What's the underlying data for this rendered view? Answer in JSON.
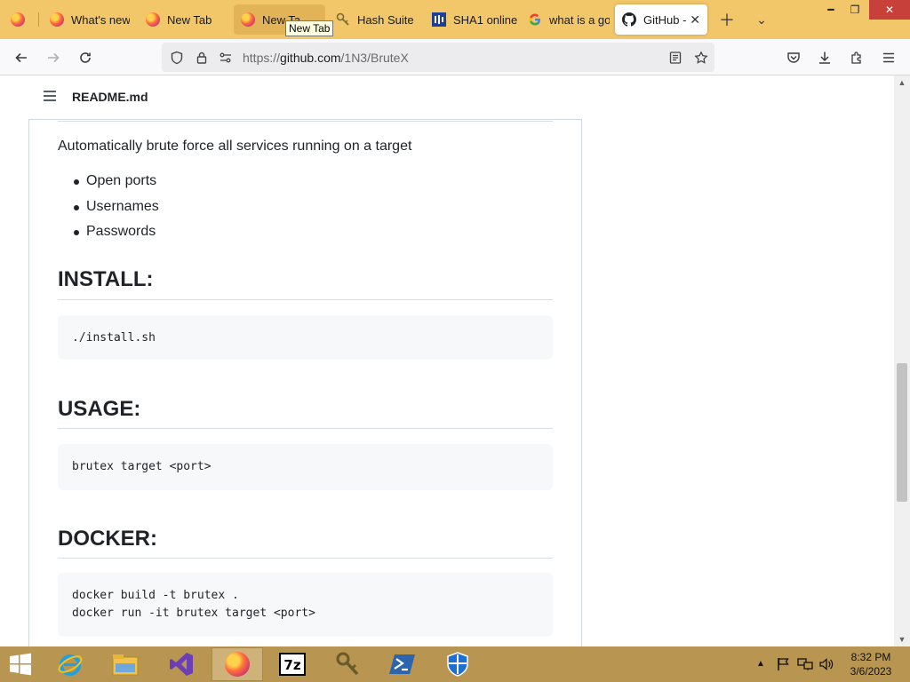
{
  "browser": {
    "tabs": [
      {
        "label": "",
        "icon": "firefox-icon"
      },
      {
        "label": "What's new",
        "icon": "firefox-icon"
      },
      {
        "label": "New Tab",
        "icon": "firefox-icon"
      },
      {
        "label": "New Ta",
        "icon": "firefox-icon"
      },
      {
        "label": "Hash Suite",
        "icon": "keys-icon"
      },
      {
        "label": "SHA1 online",
        "icon": "sha1-site-icon"
      },
      {
        "label": "what is a go",
        "icon": "google-icon"
      },
      {
        "label": "GitHub -",
        "icon": "github-icon"
      }
    ],
    "tooltip": "New Tab",
    "url": {
      "prefix": "https://",
      "host": "github.com",
      "path": "/1N3/BruteX"
    }
  },
  "readme": {
    "filename": "README.md",
    "description": "Automatically brute force all services running on a target",
    "features": [
      "Open ports",
      "Usernames",
      "Passwords"
    ],
    "sections": [
      {
        "heading": "INSTALL:",
        "code": "./install.sh"
      },
      {
        "heading": "USAGE:",
        "code": "brutex target <port>"
      },
      {
        "heading": "DOCKER:",
        "code": "docker build -t brutex .\ndocker run -it brutex target <port>"
      }
    ]
  },
  "taskbar": {
    "apps": [
      "windows-start",
      "internet-explorer",
      "file-explorer",
      "visual-studio",
      "firefox",
      "7zip",
      "hash-suite",
      "powershell",
      "windows-defender"
    ],
    "clock": {
      "time": "8:32 PM",
      "date": "3/6/2023"
    }
  }
}
